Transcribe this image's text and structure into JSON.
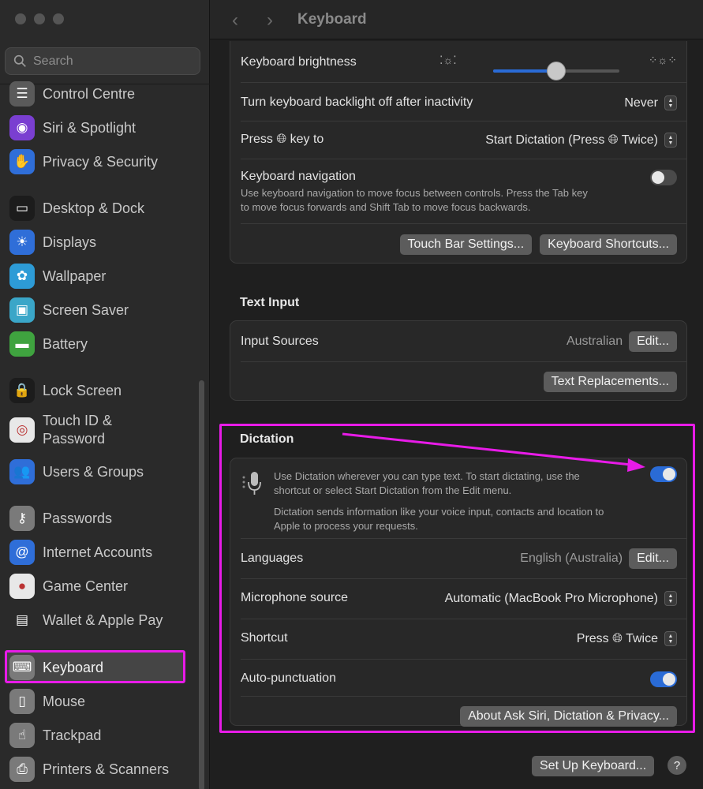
{
  "window": {
    "title": "Keyboard"
  },
  "sidebar": {
    "search_placeholder": "Search",
    "items": [
      {
        "label": "Control Centre",
        "icon": "control-centre-icon",
        "color": "#5a5a5a",
        "glyph": "☰"
      },
      {
        "label": "Siri & Spotlight",
        "icon": "siri-icon",
        "color": "#7a3fd1",
        "glyph": "◉"
      },
      {
        "label": "Privacy & Security",
        "icon": "hand-icon",
        "color": "#2f6ed8",
        "glyph": "✋"
      },
      {
        "label": "Desktop & Dock",
        "icon": "dock-icon",
        "color": "#1c1c1c",
        "glyph": "▭"
      },
      {
        "label": "Displays",
        "icon": "sun-icon",
        "color": "#2f6ed8",
        "glyph": "☀"
      },
      {
        "label": "Wallpaper",
        "icon": "flower-icon",
        "color": "#2d9bd6",
        "glyph": "✿"
      },
      {
        "label": "Screen Saver",
        "icon": "screen-saver-icon",
        "color": "#3aa6c8",
        "glyph": "▣"
      },
      {
        "label": "Battery",
        "icon": "battery-icon",
        "color": "#3fa33f",
        "glyph": "▬"
      },
      {
        "label": "Lock Screen",
        "icon": "lock-icon",
        "color": "#1c1c1c",
        "glyph": "🔒"
      },
      {
        "label": "Touch ID &",
        "label2": "Password",
        "icon": "fingerprint-icon",
        "color": "#e8e8e8",
        "glyph": "◎"
      },
      {
        "label": "Users & Groups",
        "icon": "users-icon",
        "color": "#2f6ed8",
        "glyph": "👥"
      },
      {
        "label": "Passwords",
        "icon": "key-icon",
        "color": "#7a7a7a",
        "glyph": "⚷"
      },
      {
        "label": "Internet Accounts",
        "icon": "at-icon",
        "color": "#2f6ed8",
        "glyph": "@"
      },
      {
        "label": "Game Center",
        "icon": "game-center-icon",
        "color": "#e8e8e8",
        "glyph": "●"
      },
      {
        "label": "Wallet & Apple Pay",
        "icon": "wallet-icon",
        "color": "#2a2a2a",
        "glyph": "▤"
      },
      {
        "label": "Keyboard",
        "icon": "keyboard-icon",
        "color": "#7a7a7a",
        "glyph": "⌨"
      },
      {
        "label": "Mouse",
        "icon": "mouse-icon",
        "color": "#7a7a7a",
        "glyph": "▯"
      },
      {
        "label": "Trackpad",
        "icon": "trackpad-icon",
        "color": "#7a7a7a",
        "glyph": "☝"
      },
      {
        "label": "Printers & Scanners",
        "icon": "printer-icon",
        "color": "#7a7a7a",
        "glyph": "⎙"
      }
    ]
  },
  "keyboard": {
    "brightness_label": "Keyboard brightness",
    "brightness_level": 0.5,
    "backlight_label": "Turn keyboard backlight off after inactivity",
    "backlight_value": "Never",
    "press_key_label_a": "Press",
    "press_key_label_b": "key to",
    "press_key_value_a": "Start Dictation (Press",
    "press_key_value_b": "Twice)",
    "nav_label": "Keyboard navigation",
    "nav_desc_1": "Use keyboard navigation to move focus between controls. Press the Tab key",
    "nav_desc_2": "to move focus forwards and Shift Tab to move focus backwards.",
    "touchbar_button": "Touch Bar Settings...",
    "shortcuts_button": "Keyboard Shortcuts..."
  },
  "text_input": {
    "title": "Text Input",
    "sources_label": "Input Sources",
    "sources_value": "Australian",
    "edit_button": "Edit...",
    "replacements_button": "Text Replacements..."
  },
  "dictation": {
    "title": "Dictation",
    "desc_1": "Use Dictation wherever you can type text. To start dictating, use the",
    "desc_2": "shortcut or select Start Dictation from the Edit menu.",
    "desc_3": "Dictation sends information like your voice input, contacts and location to",
    "desc_4": "Apple to process your requests.",
    "languages_label": "Languages",
    "languages_value": "English (Australia)",
    "edit_button": "Edit...",
    "mic_label": "Microphone source",
    "mic_value": "Automatic (MacBook Pro Microphone)",
    "shortcut_label": "Shortcut",
    "shortcut_value_a": "Press",
    "shortcut_value_b": "Twice",
    "autopunct_label": "Auto-punctuation",
    "about_button": "About Ask Siri, Dictation & Privacy..."
  },
  "footer": {
    "setup_button": "Set Up Keyboard...",
    "help_button": "?"
  },
  "colors": {
    "accent": "#2a6bd6",
    "highlight": "#e81be8"
  }
}
